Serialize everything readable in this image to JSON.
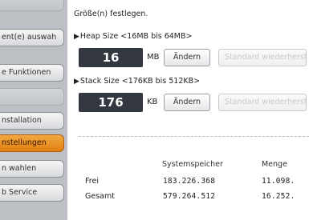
{
  "sidebar": {
    "items": [
      {
        "label": ""
      },
      {
        "label": "ent(e) auswah"
      },
      {
        "label": "e Funktionen"
      },
      {
        "label": ""
      },
      {
        "label": "nstallation"
      },
      {
        "label": "nstellungen"
      },
      {
        "label": "n wahlen"
      },
      {
        "label": "b Service"
      }
    ]
  },
  "main": {
    "instruction": "Größe(n) festlegen.",
    "heap": {
      "label": "Heap Size <16MB bis 64MB>",
      "value": "16",
      "unit": "MB",
      "change_button": "Ändern",
      "default_button": "Standard wiederherst"
    },
    "stack": {
      "label": "Stack Size <176KB bis 512KB>",
      "value": "176",
      "unit": "KB",
      "change_button": "Ändern",
      "default_button": "Standard wiederherst"
    },
    "memory_table": {
      "columns": [
        "Systemspeicher",
        "Menge"
      ],
      "rows": [
        {
          "label": "Frei",
          "system": "183.226.368",
          "menge": "11.098."
        },
        {
          "label": "Gesamt",
          "system": "579.264.512",
          "menge": "16.252."
        }
      ]
    }
  },
  "colors": {
    "sidebar_bg": "#bcc0c4",
    "active_item": "#e8901e",
    "value_box": "#33373f"
  }
}
